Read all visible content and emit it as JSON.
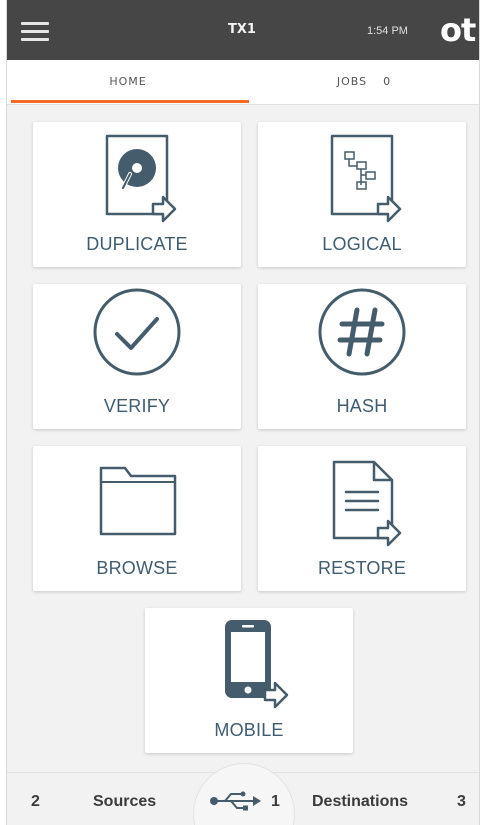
{
  "header": {
    "device_name": "TX1",
    "time": "1:54 PM",
    "logo_text": "ot"
  },
  "tabs": {
    "home_label": "HOME",
    "jobs_label": "JOBS",
    "jobs_count": "0",
    "active": "HOME"
  },
  "tiles": {
    "duplicate": "DUPLICATE",
    "logical": "LOGICAL",
    "verify": "VERIFY",
    "hash": "HASH",
    "browse": "BROWSE",
    "restore": "RESTORE",
    "mobile": "MOBILE"
  },
  "footer": {
    "sources_count": "2",
    "sources_label": "Sources",
    "usb_count": "1",
    "destinations_label": "Destinations",
    "destinations_count": "3"
  },
  "icons": {
    "menu": "hamburger-menu-icon",
    "duplicate": "hard-drive-document-icon",
    "logical": "file-tree-document-icon",
    "verify": "check-circle-icon",
    "hash": "hash-circle-icon",
    "browse": "folder-icon",
    "restore": "text-document-icon",
    "mobile": "smartphone-icon",
    "usb": "usb-icon"
  },
  "colors": {
    "accent": "#f26b2d",
    "icon": "#445c6b",
    "header_bg": "#464646"
  }
}
